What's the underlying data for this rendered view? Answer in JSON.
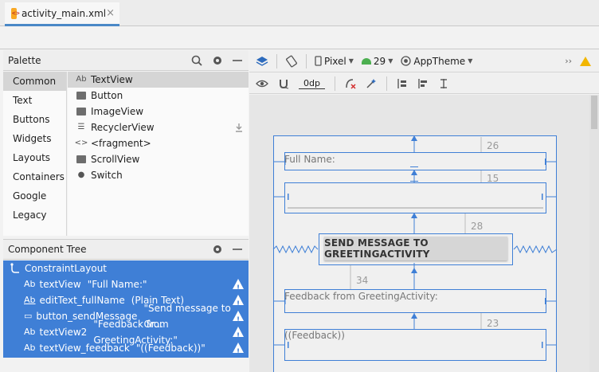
{
  "editor_tab": {
    "filename": "activity_main.xml",
    "close": "×"
  },
  "palette": {
    "title": "Palette",
    "categories": [
      "Common",
      "Text",
      "Buttons",
      "Widgets",
      "Layouts",
      "Containers",
      "Google",
      "Legacy"
    ],
    "selected_category": "Common",
    "items": [
      {
        "label": "TextView",
        "icon": "textview-icon",
        "glyph": "Ab"
      },
      {
        "label": "Button",
        "icon": "button-icon",
        "glyph": ""
      },
      {
        "label": "ImageView",
        "icon": "imageview-icon",
        "glyph": ""
      },
      {
        "label": "RecyclerView",
        "icon": "recyclerview-icon",
        "glyph": "☰"
      },
      {
        "label": "<fragment>",
        "icon": "fragment-icon",
        "glyph": "<>"
      },
      {
        "label": "ScrollView",
        "icon": "scrollview-icon",
        "glyph": ""
      },
      {
        "label": "Switch",
        "icon": "switch-icon",
        "glyph": "●"
      }
    ]
  },
  "component_tree": {
    "title": "Component Tree",
    "root": "ConstraintLayout",
    "rows": [
      {
        "glyph": "Ab",
        "id": "textView",
        "detail": "\"Full Name:\""
      },
      {
        "glyph": "Ab",
        "id": "editText_fullName",
        "detail": "(Plain Text)"
      },
      {
        "glyph": "▭",
        "id": "button_sendMessage",
        "detail": "\"Send message to Gr..."
      },
      {
        "glyph": "Ab",
        "id": "textView2",
        "detail": "\"Feedback from GreetingActivity:\""
      },
      {
        "glyph": "Ab",
        "id": "textView_feedback",
        "detail": "\"((Feedback))\""
      }
    ]
  },
  "design_toolbar": {
    "device": "Pixel",
    "api_level": "29",
    "theme": "AppTheme",
    "default_margin": "0dp",
    "overflow": "››"
  },
  "layout_preview": {
    "textView_text": "Full Name:",
    "button_text": "SEND MESSAGE TO GREETINGACTIVITY",
    "textView2_text": "Feedback from GreetingActivity:",
    "textView_feedback_text": "((Feedback))",
    "margins": [
      "26",
      "15",
      "28",
      "34",
      "23"
    ]
  },
  "colors": {
    "selection_blue": "#3f7fd6",
    "constraint_blue": "#3f7fd6",
    "warning_yellow": "#f2b600"
  }
}
